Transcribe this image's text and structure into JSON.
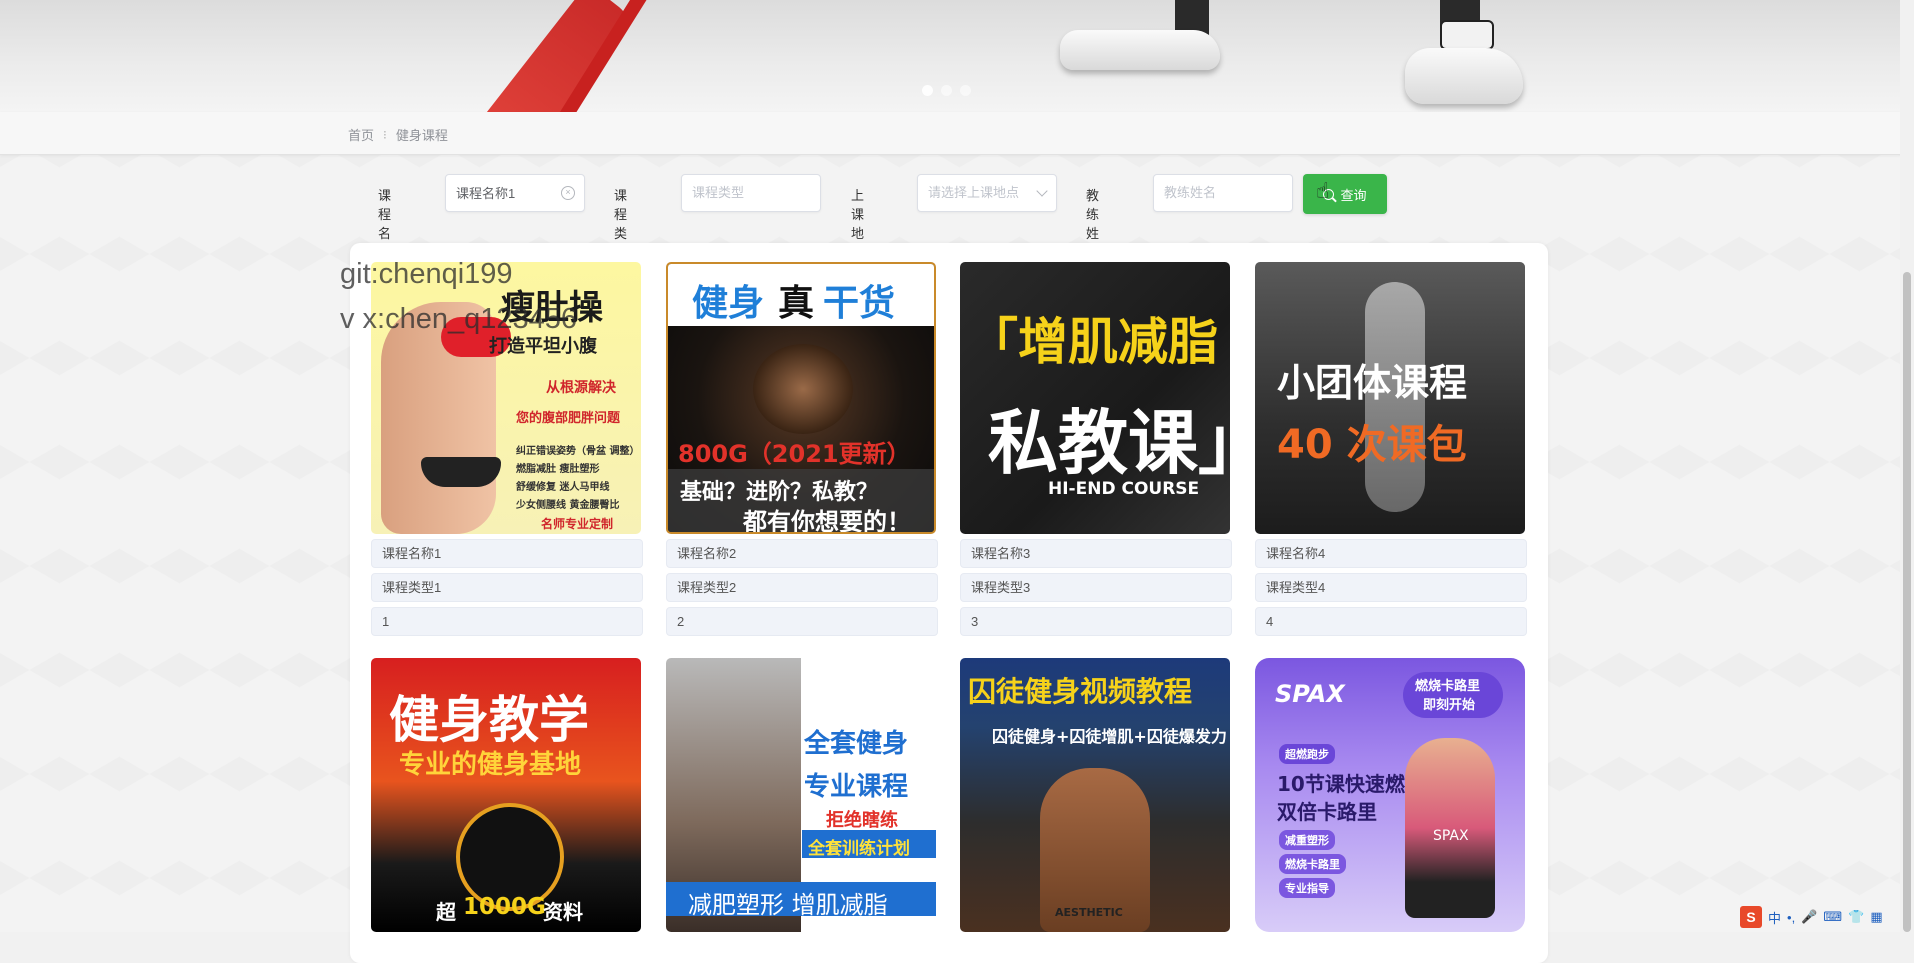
{
  "breadcrumb": {
    "home": "首页",
    "separator": "⁝",
    "current": "健身课程"
  },
  "filters": {
    "course_name_label": "课程名称",
    "course_name_value": "课程名称1",
    "course_type_label": "课程类型",
    "course_type_placeholder": "课程类型",
    "location_label": "上课地点",
    "location_placeholder": "请选择上课地点",
    "coach_label": "教练姓名",
    "coach_placeholder": "教练姓名",
    "query_button": "查询"
  },
  "watermark": {
    "line1": "git:chenqi199",
    "line2": "v x:chen_q123456"
  },
  "courses": [
    {
      "name": "课程名称1",
      "type": "课程类型1",
      "value": "1",
      "poster": {
        "t1": "瘦肚操",
        "t2": "打造平坦小腹",
        "t3": "从根源解决",
        "t4": "您的腹部肥胖问题",
        "t5": "纠正错误姿势（骨盆 调整）",
        "t6": "燃脂减肚 瘦肚塑形",
        "t7": "舒缓修复 迷人马甲线",
        "t8": "少女侧腰线 黄金腰臀比",
        "t9": "名师专业定制"
      }
    },
    {
      "name": "课程名称2",
      "type": "课程类型2",
      "value": "2",
      "poster": {
        "t1": "健身",
        "t2": "真",
        "t3": "干货",
        "t4": "800G（2021更新）",
        "t5": "基础？进阶？私教？",
        "t6": "都有你想要的！"
      }
    },
    {
      "name": "课程名称3",
      "type": "课程类型3",
      "value": "3",
      "poster": {
        "t1": "「增肌减脂",
        "t2": "私教课」",
        "t3": "HI-END COURSE"
      }
    },
    {
      "name": "课程名称4",
      "type": "课程类型4",
      "value": "4",
      "poster": {
        "t1": "小团体课程",
        "t2": "40 次课包"
      }
    }
  ],
  "courses_row2": [
    {
      "poster": {
        "t1": "健身教学",
        "t2": "专业的健身基地",
        "t3": "超",
        "t4": "1000G",
        "t5": "资料"
      }
    },
    {
      "poster": {
        "t1": "全套健身",
        "t2": "专业课程",
        "t3": "拒绝瞎练",
        "t4": "全套训练计划",
        "t5": "减肥塑形 增肌减脂"
      }
    },
    {
      "poster": {
        "t1": "囚徒健身视频教程",
        "t2": "囚徒健身+囚徒增肌+囚徒爆发力",
        "t3": "AESTHETIC"
      }
    },
    {
      "poster": {
        "t1": "SPAX",
        "t2": "燃烧卡路里",
        "t3": "即刻开始",
        "t4": "超燃跑步",
        "t5": "10节课快速燃烧",
        "t6": "双倍卡路里",
        "t7": "减重塑形",
        "t8": "燃烧卡路里",
        "t9": "专业指导",
        "t10": "SPAX"
      }
    }
  ],
  "ime": {
    "logo": "S",
    "lang": "中",
    "punct": "•,",
    "mic": "🎤",
    "kbd": "⌨",
    "shirt": "👕",
    "grid": "▦"
  },
  "colors": {
    "query_button": "#3ab54a",
    "banner_band": "#c8211f",
    "field_bg": "#f0f3f9"
  }
}
